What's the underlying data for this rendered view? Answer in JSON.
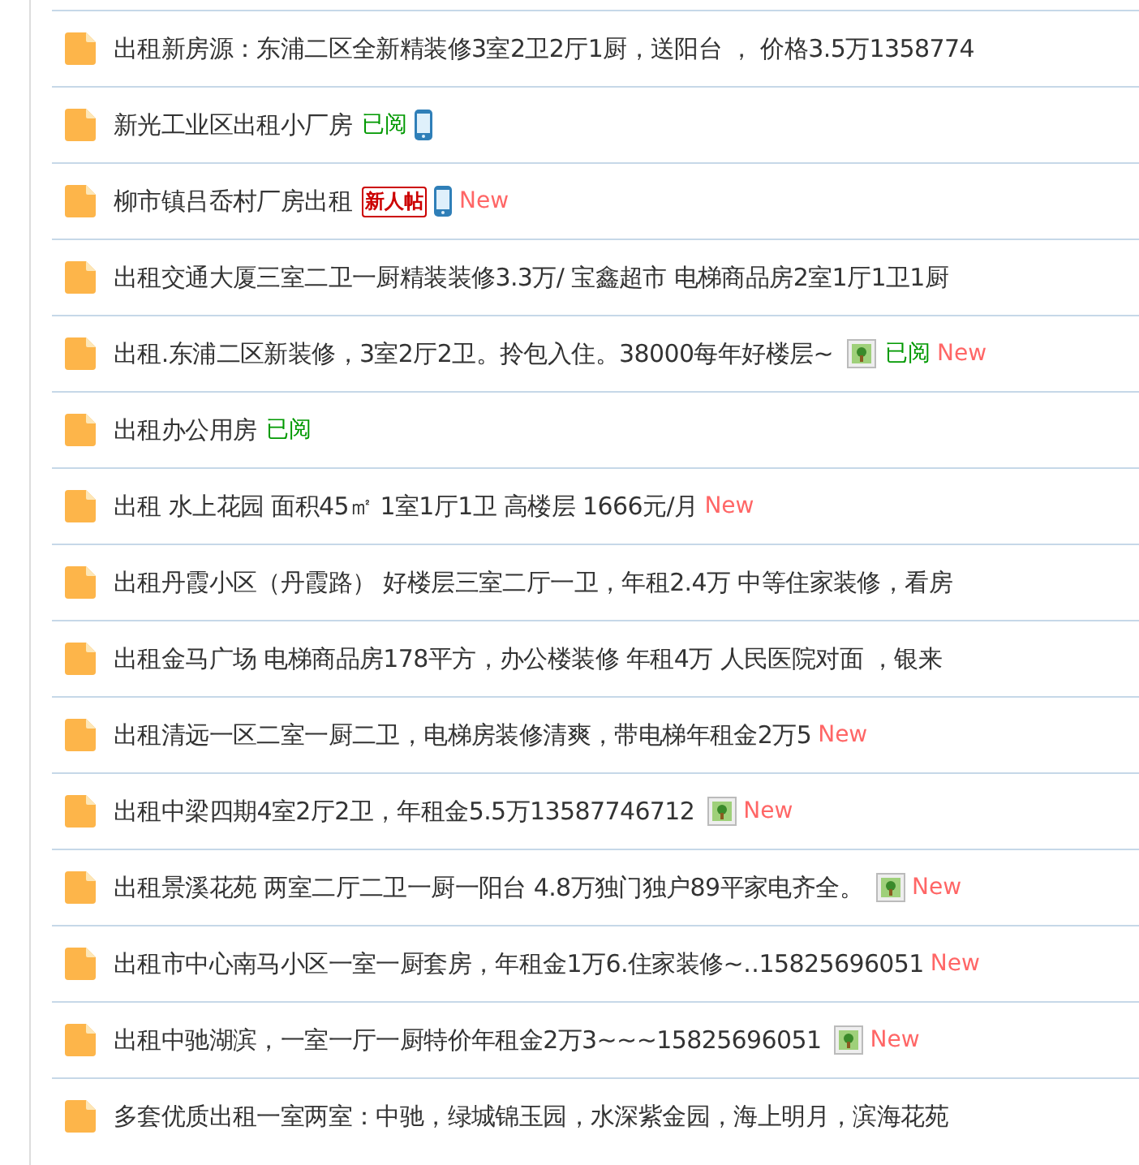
{
  "threads": [
    {
      "title": "出租新房源：东浦二区全新精装修3室2卫2厅1厨，送阳台 ， 价格3.5万1358774"
    },
    {
      "title": "新光工业区出租小厂房",
      "tags": [
        {
          "kind": "read",
          "text": "已阅"
        },
        {
          "kind": "phone"
        }
      ]
    },
    {
      "title": "柳市镇吕岙村厂房出租",
      "tags": [
        {
          "kind": "newbie",
          "text": "新人帖"
        },
        {
          "kind": "phone"
        },
        {
          "kind": "new",
          "text": "New"
        }
      ]
    },
    {
      "title": "出租交通大厦三室二卫一厨精装装修3.3万/ 宝鑫超市 电梯商品房2室1厅1卫1厨"
    },
    {
      "title": "出租.东浦二区新装修，3室2厅2卫。拎包入住。38000每年好楼层~",
      "tags": [
        {
          "kind": "image"
        },
        {
          "kind": "read",
          "text": "已阅"
        },
        {
          "kind": "new",
          "text": "New"
        }
      ]
    },
    {
      "title": "出租办公用房",
      "tags": [
        {
          "kind": "read",
          "text": "已阅"
        }
      ]
    },
    {
      "title": "出租 水上花园 面积45㎡ 1室1厅1卫 高楼层 1666元/月",
      "tags": [
        {
          "kind": "new",
          "text": "New"
        }
      ]
    },
    {
      "title": "出租丹霞小区（丹霞路） 好楼层三室二厅一卫，年租2.4万 中等住家装修，看房"
    },
    {
      "title": "出租金马广场 电梯商品房178平方，办公楼装修 年租4万 人民医院对面 ，银来"
    },
    {
      "title": "出租清远一区二室一厨二卫，电梯房装修清爽，带电梯年租金2万5",
      "tags": [
        {
          "kind": "new",
          "text": "New"
        }
      ]
    },
    {
      "title": "出租中梁四期4室2厅2卫，年租金5.5万13587746712",
      "tags": [
        {
          "kind": "image"
        },
        {
          "kind": "new",
          "text": "New"
        }
      ]
    },
    {
      "title": "出租景溪花苑 两室二厅二卫一厨一阳台 4.8万独门独户89平家电齐全。",
      "tags": [
        {
          "kind": "image"
        },
        {
          "kind": "new",
          "text": "New"
        }
      ]
    },
    {
      "title": "出租市中心南马小区一室一厨套房，年租金1万6.住家装修~‥15825696051",
      "tags": [
        {
          "kind": "new",
          "text": "New"
        }
      ]
    },
    {
      "title": "出租中驰湖滨，一室一厅一厨特价年租金2万3~~~15825696051",
      "tags": [
        {
          "kind": "image"
        },
        {
          "kind": "new",
          "text": "New"
        }
      ]
    },
    {
      "title": "多套优质出租一室两室：中驰，绿城锦玉园，水深紫金园，海上明月，滨海花苑"
    }
  ]
}
